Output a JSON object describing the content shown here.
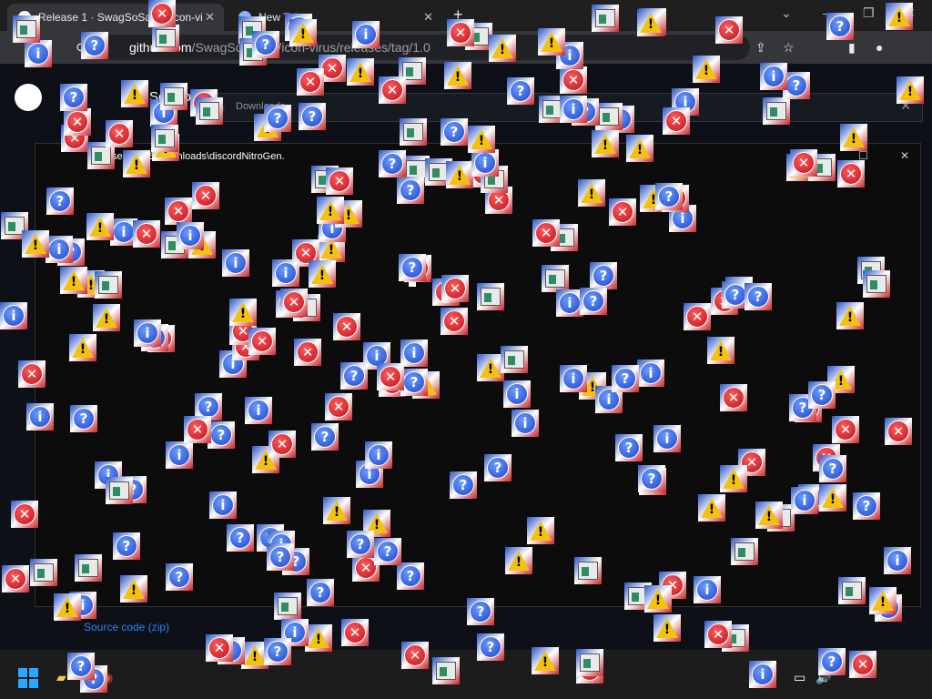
{
  "browser": {
    "tabs": [
      {
        "title": "Release 1 · SwagSoSaucy/icon-vi",
        "active": true
      },
      {
        "title": "New Tab",
        "active": false
      }
    ],
    "new_tab_glyph": "+",
    "window_controls": {
      "minimize": "—",
      "restore": "❐",
      "close": "✕",
      "dropdown": "⌄"
    },
    "address": {
      "host": "github.com",
      "path": "/SwagSoSaucy/icon-virus/releases/tag/1.0"
    }
  },
  "page": {
    "nav_label": "Solutions",
    "download_label": "Downloads",
    "source_link": "Source code (zip)"
  },
  "console": {
    "title": "C:\\Users\\VM6\\Downloads\\discordNitroGen.",
    "controls": {
      "minimize": "—",
      "maximize": "☐",
      "close": "✕"
    }
  },
  "colors": {
    "accent": "#2f81f7",
    "error": "#c0121c",
    "info": "#1b45c8",
    "warning": "#f4c20d",
    "console_bg": "#0c0c0c"
  },
  "icon_types": [
    "error-icon",
    "info-icon",
    "question-icon",
    "warning-icon",
    "app-window-icon"
  ]
}
